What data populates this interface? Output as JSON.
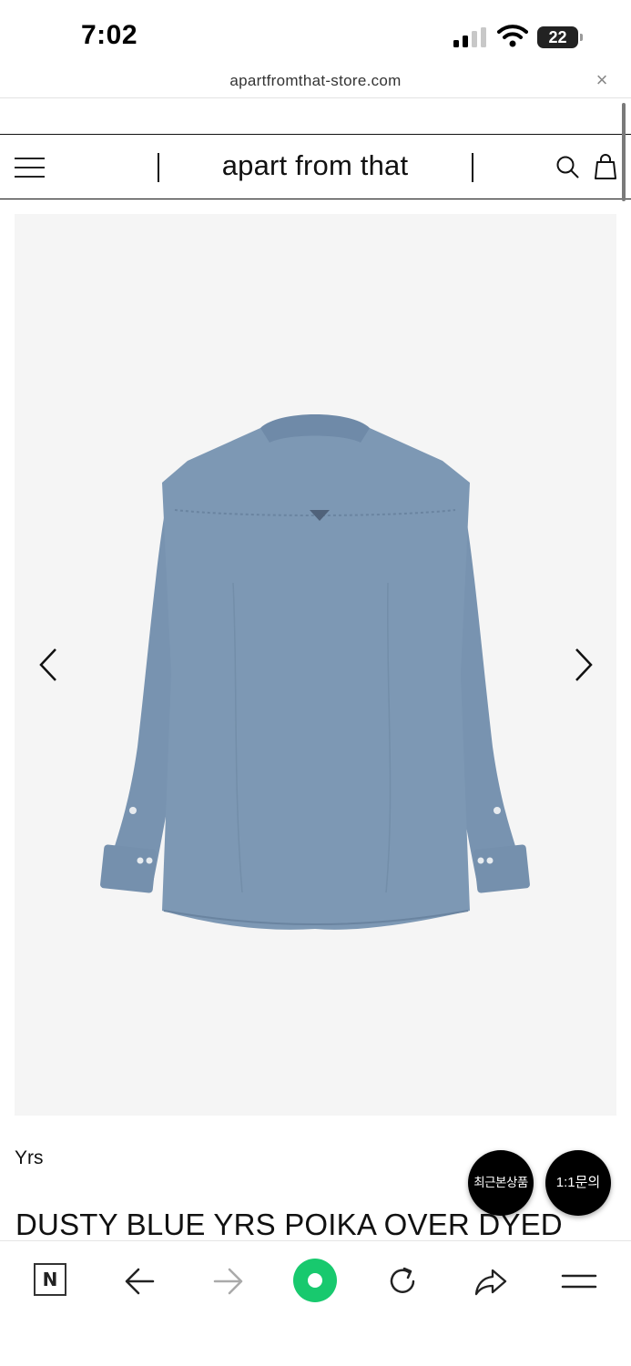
{
  "status_bar": {
    "time": "7:02",
    "battery": "22"
  },
  "browser": {
    "url": "apartfromthat-store.com",
    "close_label": "×"
  },
  "header": {
    "brand": "apart from that"
  },
  "product": {
    "brand": "Yrs",
    "title": "DUSTY BLUE YRS POIKA OVER DYED",
    "image_alt": "dusty-blue-shirt-back-view"
  },
  "floating": {
    "recent_label": "최근본상품",
    "inquiry_label": "1:1문의"
  },
  "toolbar": {
    "n_label": "N"
  },
  "colors": {
    "accent_green": "#18c96e",
    "shirt_blue": "#7d98b4",
    "gallery_bg": "#f5f5f5"
  }
}
